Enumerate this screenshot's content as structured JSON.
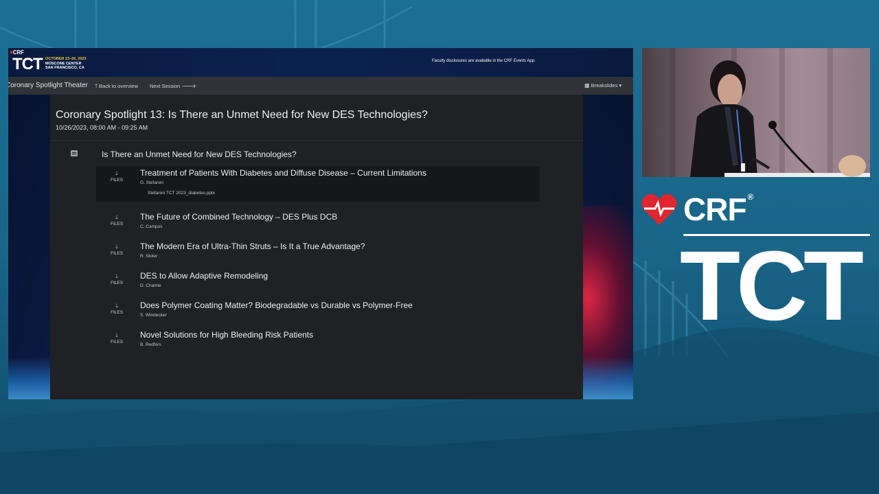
{
  "slide": {
    "banner": {
      "crf": "CRF",
      "tct": "TCT",
      "dates": "OCTOBER 23–26, 2023",
      "venue": "MOSCONE CENTER",
      "city": "SAN FRANCISCO, CA",
      "disclosure": "Faculty disclosures are available in the CRF Events App."
    },
    "nav": {
      "theater": "Coronary Spotlight Theater",
      "back": "Back to overview",
      "next": "Next Session",
      "breakslides": "Breakslides"
    },
    "session": {
      "title": "Coronary Spotlight 13: Is There an Unmet Need for New DES Technologies?",
      "date": "10/26/2023, 08:00 AM - 09:25 AM",
      "section_title": "Is There an Unmet Need for New DES Technologies?",
      "files_label": "FILES",
      "talks": [
        {
          "title": "Treatment of Patients With Diabetes and Diffuse Disease – Current Limitations",
          "speaker": "G. Stefanini",
          "file": "Stefanini TCT 2023_diabetes.pptx"
        },
        {
          "title": "The Future of Combined Technology – DES Plus DCB",
          "speaker": "C. Campos"
        },
        {
          "title": "The Modern Era of Ultra-Thin Struts – Is It a True Advantage?",
          "speaker": "R. Stoler"
        },
        {
          "title": "DES to Allow Adaptive Remodeling",
          "speaker": "D. Chamie"
        },
        {
          "title": "Does Polymer Coating Matter? Biodegradable vs Durable vs Polymer-Free",
          "speaker": "S. Windecker"
        },
        {
          "title": "Novel Solutions for High Bleeding Risk Patients",
          "speaker": "B. Redfors"
        }
      ]
    }
  },
  "logo": {
    "crf": "CRF",
    "registered": "®",
    "tct": "TCT"
  },
  "icons": {
    "nav_back": "arrow-up-icon",
    "nav_next": "arrow-right-icon",
    "breakslides": "grid-icon",
    "download": "arrow-down-icon",
    "section": "document-icon",
    "logo": "heart-icon"
  },
  "colors": {
    "background": "#1c6f95",
    "panel": "#1f2124",
    "navbar": "#2f3236",
    "accent_red": "#e23636",
    "accent_gold": "#f4c542"
  }
}
